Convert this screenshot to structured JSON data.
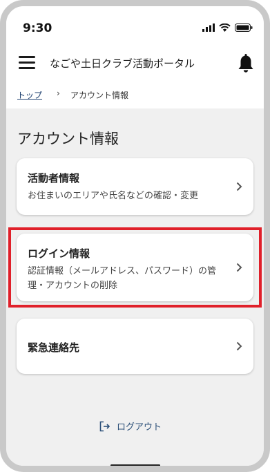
{
  "status_bar": {
    "time": "9:30"
  },
  "header": {
    "title": "なごや土日クラブ活動ポータル"
  },
  "breadcrumb": {
    "home": "トップ",
    "separator": "›",
    "current": "アカウント情報"
  },
  "page": {
    "title": "アカウント情報"
  },
  "cards": [
    {
      "title": "活動者情報",
      "description": "お住まいのエリアや氏名などの確認・変更"
    },
    {
      "title": "ログイン情報",
      "description": "認証情報（メールアドレス、パスワード）の管理・アカウントの削除"
    },
    {
      "title": "緊急連絡先",
      "description": ""
    }
  ],
  "logout": {
    "label": "ログアウト"
  },
  "colors": {
    "highlight": "#e0202a",
    "link": "#1d3f6e",
    "logout": "#2b4f78",
    "background": "#f0f0f0"
  }
}
